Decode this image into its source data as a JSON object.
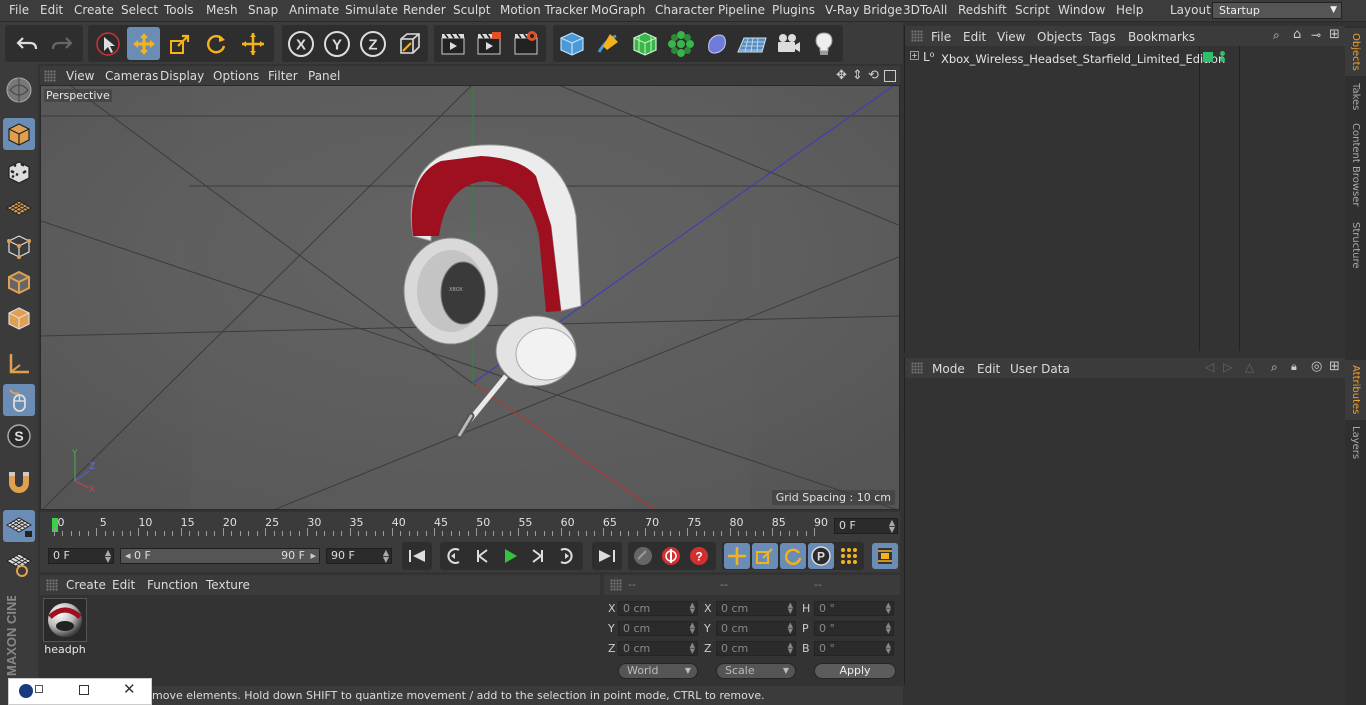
{
  "menubar": {
    "items": [
      "File",
      "Edit",
      "Create",
      "Select",
      "Tools",
      "Mesh",
      "Snap",
      "Animate",
      "Simulate",
      "Render",
      "Sculpt",
      "Motion Tracker",
      "MoGraph",
      "Character",
      "Pipeline",
      "Plugins",
      "V-Ray Bridge",
      "3DToAll",
      "Redshift",
      "Script",
      "Window",
      "Help"
    ],
    "layout_label": "Layout:",
    "layout_value": "Startup"
  },
  "toolbar": {
    "icons": [
      "undo-icon",
      "redo-icon",
      "select-icon",
      "move-icon",
      "scale-icon",
      "rotate-icon",
      "transform-icon",
      "x-axis-icon",
      "y-axis-icon",
      "z-axis-icon",
      "coord-system-icon",
      "render-view-icon",
      "render-picture-viewer-icon",
      "render-settings-icon",
      "cube-icon",
      "pen-icon",
      "subdivision-icon",
      "mograph-icon",
      "deformer-icon",
      "environment-icon",
      "camera-icon",
      "light-icon"
    ],
    "axis_letters": [
      "X",
      "Y",
      "Z"
    ]
  },
  "viewport": {
    "menu": [
      "View",
      "Cameras",
      "Display",
      "Options",
      "Filter",
      "Panel"
    ],
    "camera_label": "Perspective",
    "grid_spacing": "Grid Spacing : 10 cm"
  },
  "timeline": {
    "ticks": [
      "0",
      "5",
      "10",
      "15",
      "20",
      "25",
      "30",
      "35",
      "40",
      "45",
      "50",
      "55",
      "60",
      "65",
      "70",
      "75",
      "80",
      "85",
      "90"
    ],
    "current_frame": "0 F",
    "start_frame": "0 F",
    "range_start": "0 F",
    "range_end": "90 F",
    "end_frame": "90 F"
  },
  "materials": {
    "menu": [
      "Create",
      "Edit",
      "Function",
      "Texture"
    ],
    "items": [
      {
        "name": "headph"
      }
    ]
  },
  "coords": {
    "headers": [
      "--",
      "--",
      "--"
    ],
    "rows": [
      {
        "l1": "X",
        "v1": "0 cm",
        "l2": "X",
        "v2": "0 cm",
        "l3": "H",
        "v3": "0 °"
      },
      {
        "l1": "Y",
        "v1": "0 cm",
        "l2": "Y",
        "v2": "0 cm",
        "l3": "P",
        "v3": "0 °"
      },
      {
        "l1": "Z",
        "v1": "0 cm",
        "l2": "Z",
        "v2": "0 cm",
        "l3": "B",
        "v3": "0 °"
      }
    ],
    "world": "World",
    "scale": "Scale",
    "apply": "Apply"
  },
  "objects": {
    "menu": [
      "File",
      "Edit",
      "View",
      "Objects",
      "Tags",
      "Bookmarks"
    ],
    "items": [
      {
        "name": "Xbox_Wireless_Headset_Starfield_Limited_Edition"
      }
    ]
  },
  "attributes": {
    "menu": [
      "Mode",
      "Edit",
      "User Data"
    ]
  },
  "right_tabs": [
    "Objects",
    "Takes",
    "Content Browser",
    "Structure",
    "Attributes",
    "Layers"
  ],
  "status": {
    "text": "move elements. Hold down SHIFT to quantize movement / add to the selection in point mode, CTRL to remove."
  },
  "branding": {
    "logo_text": "MAXON CINEMA 4D"
  },
  "colors": {
    "accent_blue": "#6b8cb5",
    "active_tab": "#f0a030",
    "headset_red": "#9e1020"
  }
}
